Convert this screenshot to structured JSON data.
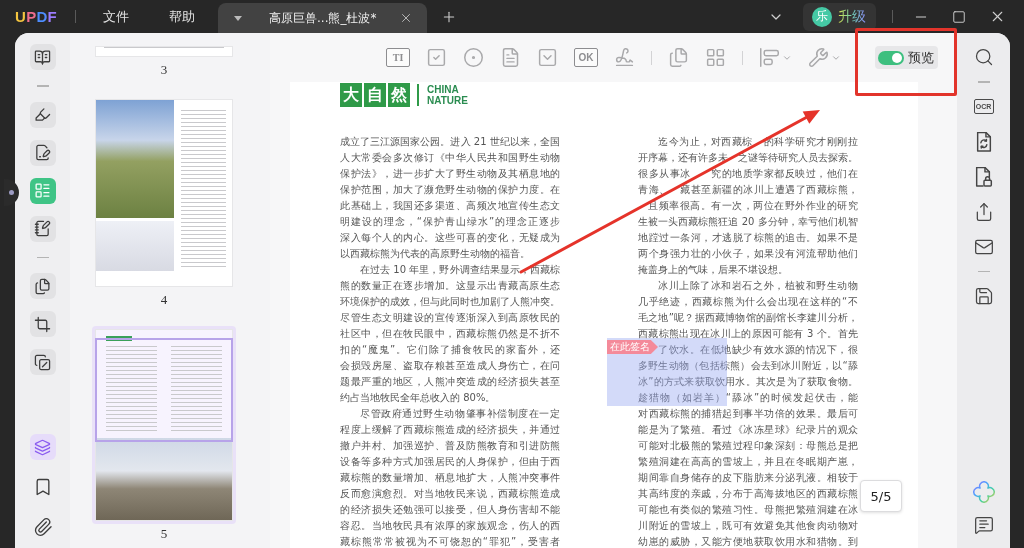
{
  "title_bar": {
    "logo": "UPDF",
    "menu": [
      "文件",
      "帮助"
    ],
    "tabs": [
      {
        "title": "高原巨兽...熊_杜波*",
        "selected": true
      }
    ],
    "upgrade": {
      "avatar": "乐",
      "label": "升级"
    }
  },
  "left_toolbar": {
    "tools": [
      {
        "kind": "reader",
        "selected": false
      },
      {
        "kind": "separator"
      },
      {
        "kind": "comment",
        "selected": false
      },
      {
        "kind": "edit",
        "selected": false
      },
      {
        "kind": "form",
        "selected": true
      },
      {
        "kind": "fill-sign",
        "selected": false
      },
      {
        "kind": "separator"
      },
      {
        "kind": "organize",
        "selected": false
      },
      {
        "kind": "crop",
        "selected": false
      },
      {
        "kind": "watermark",
        "selected": false
      }
    ],
    "panels": [
      {
        "kind": "thumbnails",
        "selected": true
      },
      {
        "kind": "bookmarks",
        "selected": false
      },
      {
        "kind": "attachments",
        "selected": false
      }
    ]
  },
  "thumbnails": [
    {
      "kind": "cut",
      "label": "3",
      "selected": false
    },
    {
      "kind": "photos",
      "label": "4",
      "selected": false
    },
    {
      "kind": "text",
      "label": "5",
      "selected": true
    }
  ],
  "form_toolbar": {
    "disabled": true,
    "tools": [
      {
        "kind": "text-field",
        "label": "TI"
      },
      {
        "kind": "checkbox"
      },
      {
        "kind": "radio"
      },
      {
        "kind": "list-box"
      },
      {
        "kind": "dropdown"
      },
      {
        "kind": "button",
        "label": "OK"
      },
      {
        "kind": "signature"
      },
      {
        "kind": "separator"
      },
      {
        "kind": "copy"
      },
      {
        "kind": "grid"
      },
      {
        "kind": "separator"
      },
      {
        "kind": "align",
        "menu": true
      },
      {
        "kind": "tools",
        "menu": true
      }
    ]
  },
  "preview": {
    "label": "预览",
    "on": true
  },
  "right_toolbar": {
    "top": [
      {
        "kind": "search"
      },
      {
        "kind": "separator"
      },
      {
        "kind": "ocr",
        "label": "OCR"
      },
      {
        "kind": "convert"
      },
      {
        "kind": "protect"
      },
      {
        "kind": "share"
      },
      {
        "kind": "email"
      },
      {
        "kind": "separator"
      },
      {
        "kind": "save"
      }
    ],
    "bottom": [
      {
        "kind": "ai"
      },
      {
        "kind": "comments"
      }
    ]
  },
  "page": {
    "logo": {
      "tiles": [
        "大",
        "自",
        "然"
      ],
      "lines": [
        "CHINA",
        "NATURE"
      ]
    },
    "columns": [
      {
        "paragraphs": [
          {
            "indent": false,
            "continues": false,
            "lines": [
              "成立了三江源国家公园。进入 21 世纪以来，全国",
              "人大常委会多次修订《中华人民共和国野生动物",
              "保护法》，进一步扩大了野生动物及其栖息地的",
              "保护范围，加大了濒危野生动物的保护力度。在",
              "此基础上，我国还多渠道、高频次地宣传生态文",
              "明建设的理念，“保护青山绿水”的理念正逐步",
              "深入每个人的内心。这些可喜的变化，无疑成为",
              "以西藏棕熊为代表的高原野生动物的福音。"
            ]
          },
          {
            "indent": true,
            "continues": false,
            "lines": [
              "在过去 10 年里，野外调查结果显示，西藏棕",
              "熊的数量正在逐步增加。这显示出青藏高原生态",
              "环境保护的成效，但与此同时也加剧了人熊冲突。",
              "尽管生态文明建设的宣传逐渐深入到高原牧民的",
              "社区中，但在牧民眼中，西藏棕熊仍然是不折不",
              "扣的“魔鬼”。它们除了捕食牧民的家畜外，还",
              "会损毁房屋、盗取存粮甚至造成人身伤亡，在问",
              "题最严重的地区，人熊冲突造成的经济损失甚至",
              "约占当地牧民全年总收入的 80%。"
            ]
          },
          {
            "indent": true,
            "continues": true,
            "lines": [
              "尽管政府通过野生动物肇事补偿制度在一定",
              "程度上缓解了西藏棕熊造成的经济损失，并通过",
              "撤户并村、加强巡护、普及防熊教育和引进防熊",
              "设备等多种方式加强居民的人身保护，但由于西",
              "藏棕熊的数量增加、栖息地扩大，人熊冲突事件",
              "反而愈演愈烈。对当地牧民来说，西藏棕熊造成",
              "的经济损失还勉强可以接受，但人身伤害却不能",
              "容忍。当地牧民具有浓厚的家族观念，伤人的西",
              "藏棕熊常常被视为不可饶恕的“罪犯”，受害者"
            ]
          }
        ]
      },
      {
        "paragraphs": [
          {
            "indent": true,
            "continues": false,
            "lines": [
              {
                "segments": [
                  "迄今为止，对西藏棕",
                  {
                    "kind": "covered"
                  },
                  "的科学研究才刚刚拉"
                ]
              },
              {
                "segments": [
                  "开序幕，还有许多未",
                  {
                    "kind": "covered"
                  },
                  "之谜等待研究人员去探索。"
                ]
              },
              {
                "segments": [
                  "很多从事冰",
                  {
                    "kind": "covered"
                  },
                  {
                    "kind": "covered"
                  },
                  "究的地质学家都反映过，他们在"
                ]
              },
              {
                "segments": [
                  "青海、",
                  {
                    "kind": "covered"
                  },
                  "藏甚至新疆的冰川上遭遇了西藏棕熊，"
                ]
              },
              {
                "segments": [
                  {
                    "kind": "covered"
                  },
                  "且频率很高。有一次，两位在野外作业的研究"
                ]
              },
              "生被一头西藏棕熊狂追 20 多分钟，幸亏他们机智",
              "地蹚过一条河，才逃脱了棕熊的追击。如果不是",
              "两个身强力壮的小伙子，如果没有河流帮助他们",
              "掩盖身上的气味，后果不堪设想。"
            ]
          },
          {
            "indent": true,
            "continues": true,
            "lines": [
              "冰川上除了冰和岩石之外，植被和野生动物",
              "几乎绝迹，西藏棕熊为什么会出现在这样的“不",
              "毛之地”呢？据西藏博物馆的副馆长李建川分析，",
              "西藏棕熊出现在冰川上的原因可能有 3 个。首先",
              {
                "segments": [
                  {
                    "kind": "covered"
                  },
                  {
                    "kind": "covered"
                  },
                  "了饮水。在低地缺少有效水源的情况下，很"
                ]
              },
              "多野生动物（包括棕熊）会去到冰川附近，以“舔",
              "冰”的方式来获取饮用水。其次是为了获取食物。",
              "趁猎物（如岩羊）“舔冰”的时候发起伏击，能",
              "对西藏棕熊的捕猎起到事半功倍的效果。最后可",
              "能是为了繁殖。看过《冰冻星球》纪录片的观众",
              "可能对北极熊的繁殖过程印象深刻：母熊总是把",
              "繁殖洞建在高高的雪坡上，并且在冬眠期产崽，",
              "期间靠自身储存的皮下脂肪来分泌乳液。相较于",
              "其高纬度的亲戚，分布于高海拔地区的西藏棕熊",
              "可能也有类似的繁殖习性。母熊把繁殖洞建在冰",
              "川附近的雪坡上，既可有效避免其他食肉动物对",
              "幼崽的威胁，又能方便地获取饮用水和猎物。到"
            ]
          }
        ]
      }
    ],
    "signature_field": {
      "label": "在此签名"
    }
  },
  "page_indicator": "5/5"
}
